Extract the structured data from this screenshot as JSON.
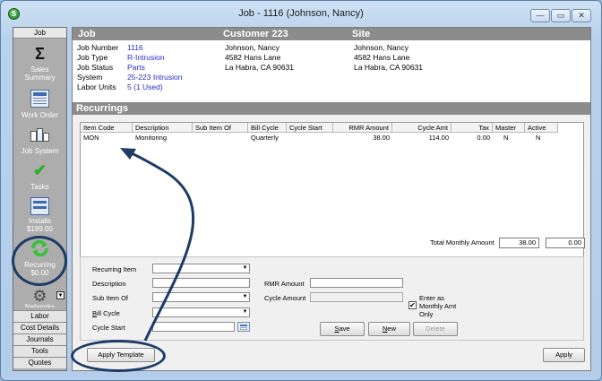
{
  "window": {
    "title": "Job - 1116 (Johnson, Nancy)",
    "app_icon_glyph": "S",
    "minimize_glyph": "—",
    "restore_glyph": "▭",
    "close_glyph": "✕"
  },
  "sidebar": {
    "top_tab": "Job",
    "items": [
      {
        "icon": "sigma-icon",
        "glyph": "Σ",
        "label": "Sales\nSummary"
      },
      {
        "icon": "work-order-icon",
        "label": "Work Order"
      },
      {
        "icon": "job-system-icon",
        "label": "Job System"
      },
      {
        "icon": "checkmark-icon",
        "glyph": "✔",
        "label": "Tasks"
      },
      {
        "icon": "installs-icon",
        "label": "Installs\n$199.00"
      },
      {
        "icon": "recurring-icon",
        "label": "Recurring\n$0.00"
      },
      {
        "icon": "gear-icon",
        "label": "Networks"
      }
    ],
    "bottom_tabs": [
      "Labor",
      "Cost Details",
      "Journals",
      "Tools",
      "Quotes"
    ]
  },
  "header": {
    "job": "Job",
    "customer": "Customer 223",
    "site": "Site"
  },
  "job_info": {
    "labels": [
      "Job Number",
      "Job Type",
      "Job Status",
      "System",
      "Labor Units"
    ],
    "values": [
      "1116",
      "R-Intrusion",
      "Parts",
      "25-223 Intrusion",
      "5 (1 Used)"
    ]
  },
  "customer_address": [
    "Johnson, Nancy",
    "4582 Hans Lane",
    "La Habra, CA  90631"
  ],
  "site_address": [
    "Johnson, Nancy",
    "4582 Hans Lane",
    "La Habra, CA  90631"
  ],
  "recurrings": {
    "title": "Recurrings",
    "columns": [
      "Item Code",
      "Description",
      "Sub Item Of",
      "Bill Cycle",
      "Cycle Start",
      "RMR Amount",
      "Cycle Amt",
      "Tax",
      "Master",
      "Active"
    ],
    "rows": [
      [
        "MON",
        "Monitoring",
        "",
        "Quarterly",
        "",
        "38.00",
        "114.00",
        "0.00",
        "N",
        "N"
      ]
    ],
    "total_label": "Total Monthly Amount",
    "total_value": "38.00",
    "total_tax": "0.00"
  },
  "form": {
    "recurring_item_label": "Recurring Item",
    "description_label": "Description",
    "sub_item_of_label": "Sub Item Of",
    "bill_cycle_label": "Bill Cycle",
    "cycle_start_label": "Cycle Start",
    "rmr_amount_label": "RMR Amount",
    "cycle_amount_label": "Cycle Amount",
    "enter_as_monthly_label": "Enter as\nMonthly Amt\nOnly",
    "enter_as_monthly_checked": true,
    "check_glyph": "✔",
    "save_label": "Save",
    "new_label": "New",
    "delete_label": "Delete",
    "dropdown_glyph": "▼"
  },
  "buttons": {
    "apply_template": "Apply Template",
    "apply": "Apply"
  }
}
